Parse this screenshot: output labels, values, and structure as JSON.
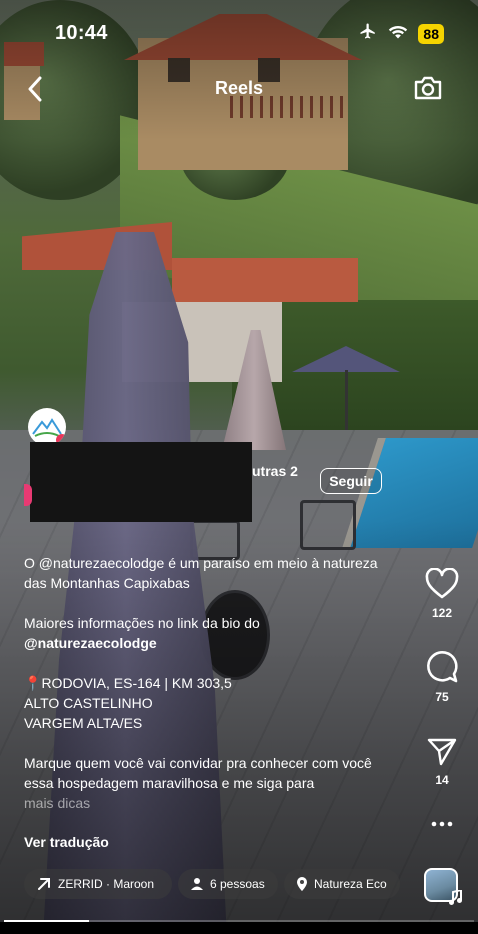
{
  "status_bar": {
    "time": "10:44",
    "battery": "88",
    "icons": [
      "airplane-icon",
      "wifi-icon"
    ]
  },
  "header": {
    "title": "Reels",
    "back_icon": "chevron-left-icon",
    "camera_icon": "camera-icon"
  },
  "author": {
    "collab_text": "utras 2",
    "follow_label": "Seguir"
  },
  "caption": {
    "line1_pre": "O ",
    "line1_mention": "@naturezaecolodge",
    "line1_post": " é um paraíso em meio à natureza das Montanhas Capixabas",
    "line2": "Maiores informações no link da bio do",
    "line3": "@naturezaecolodge",
    "pin": "📍",
    "line4": "RODOVIA, ES-164 | KM 303,5",
    "line5": "ALTO CASTELINHO",
    "line6": "VARGEM ALTA/ES",
    "line7": "Marque quem você vai convidar pra conhecer com você essa hospedagem maravilhosa e me siga para",
    "line8": "mais dicas"
  },
  "translate_label": "Ver tradução",
  "chips": {
    "music": "ZERRID · Maroon",
    "people": "6 pessoas",
    "location": "Natureza Eco"
  },
  "actions": {
    "likes": "122",
    "comments": "75",
    "shares": "14"
  },
  "progress": 0.18,
  "colors": {
    "accent_pink": "#e8365a",
    "battery": "#f5d400",
    "pin_red": "#e8413f"
  }
}
